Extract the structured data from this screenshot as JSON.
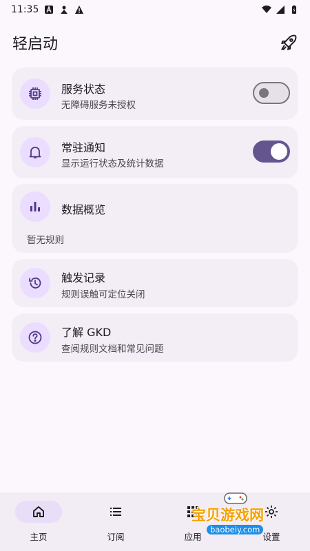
{
  "status_bar": {
    "time": "11:35"
  },
  "app_bar": {
    "title": "轻启动"
  },
  "cards": [
    {
      "title": "服务状态",
      "subtitle": "无障碍服务未授权",
      "toggle": "off"
    },
    {
      "title": "常驻通知",
      "subtitle": "显示运行状态及统计数据",
      "toggle": "on"
    },
    {
      "title": "数据概览",
      "subtitle": "暂无规则"
    },
    {
      "title": "触发记录",
      "subtitle": "规则误触可定位关闭"
    },
    {
      "title": "了解 GKD",
      "subtitle": "查阅规则文档和常见问题"
    }
  ],
  "bottom_nav": [
    {
      "label": "主页",
      "icon": "home-icon",
      "active": true
    },
    {
      "label": "订阅",
      "icon": "list-icon",
      "active": false
    },
    {
      "label": "应用",
      "icon": "apps-icon",
      "active": false
    },
    {
      "label": "设置",
      "icon": "settings-icon",
      "active": false
    }
  ],
  "watermark": {
    "text": "宝贝游戏网",
    "url": "baobeiy.com"
  },
  "colors": {
    "accent": "#65558f",
    "card_bg": "#f3eef6",
    "icon_bg": "#eaddff",
    "page_bg": "#fcf7fd"
  }
}
